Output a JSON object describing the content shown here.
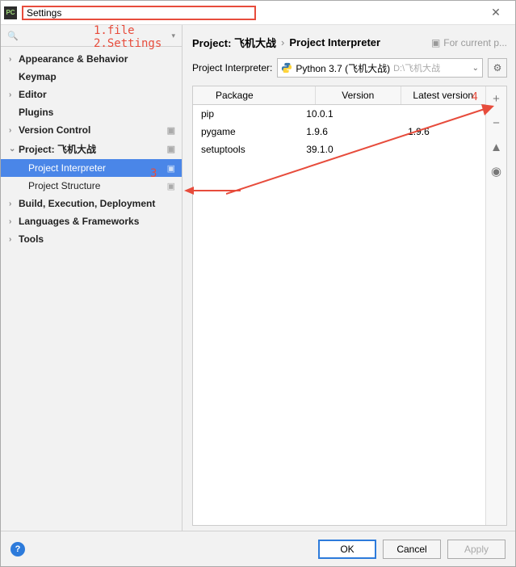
{
  "window": {
    "title": "Settings"
  },
  "annotations": {
    "a1": "1.file",
    "a2": "2.Settings",
    "a3": "3",
    "a4": "4"
  },
  "search": {
    "placeholder": ""
  },
  "tree": {
    "appearance": "Appearance & Behavior",
    "keymap": "Keymap",
    "editor": "Editor",
    "plugins": "Plugins",
    "vcs": "Version Control",
    "project": "Project: 飞机大战",
    "interpreter": "Project Interpreter",
    "structure": "Project Structure",
    "build": "Build, Execution, Deployment",
    "lang": "Languages & Frameworks",
    "tools": "Tools"
  },
  "breadcrumb": {
    "proj": "Project: 飞机大战",
    "page": "Project Interpreter",
    "scope": "For current p..."
  },
  "interpreter": {
    "label": "Project Interpreter:",
    "value": "Python 3.7 (飞机大战)",
    "path": "D:\\飞机大战"
  },
  "table": {
    "headers": {
      "pkg": "Package",
      "ver": "Version",
      "latest": "Latest version"
    },
    "rows": [
      {
        "pkg": "pip",
        "ver": "10.0.1",
        "latest": ""
      },
      {
        "pkg": "pygame",
        "ver": "1.9.6",
        "latest": "1.9.6"
      },
      {
        "pkg": "setuptools",
        "ver": "39.1.0",
        "latest": ""
      }
    ]
  },
  "footer": {
    "ok": "OK",
    "cancel": "Cancel",
    "apply": "Apply"
  }
}
